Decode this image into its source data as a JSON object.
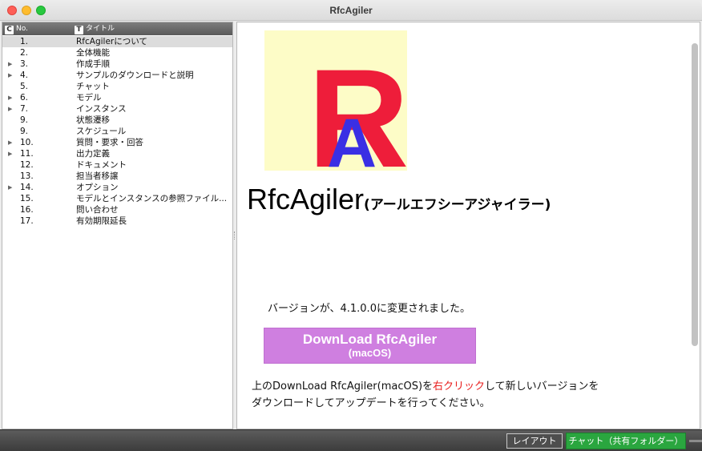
{
  "window": {
    "title": "RfcAgiler"
  },
  "sidebar": {
    "header": {
      "no_icon": "C",
      "no_label": "No.",
      "title_icon": "T",
      "title_label": "タイトル"
    },
    "rows": [
      {
        "no": "1.",
        "title": "RfcAgilerについて",
        "expandable": false,
        "selected": true
      },
      {
        "no": "2.",
        "title": "全体機能",
        "expandable": false
      },
      {
        "no": "3.",
        "title": "作成手順",
        "expandable": true
      },
      {
        "no": "4.",
        "title": "サンプルのダウンロードと説明",
        "expandable": true
      },
      {
        "no": "5.",
        "title": "チャット",
        "expandable": false
      },
      {
        "no": "6.",
        "title": "モデル",
        "expandable": true
      },
      {
        "no": "7.",
        "title": "インスタンス",
        "expandable": true
      },
      {
        "no": "9.",
        "title": "状態遷移",
        "expandable": false
      },
      {
        "no": "9.",
        "title": "スケジュール",
        "expandable": false
      },
      {
        "no": "10.",
        "title": "質問・要求・回答",
        "expandable": true
      },
      {
        "no": "11.",
        "title": "出力定義",
        "expandable": true
      },
      {
        "no": "12.",
        "title": "ドキュメント",
        "expandable": false
      },
      {
        "no": "13.",
        "title": "担当者移譲",
        "expandable": false
      },
      {
        "no": "14.",
        "title": "オプション",
        "expandable": true
      },
      {
        "no": "15.",
        "title": "モデルとインスタンスの参照ファイル...",
        "expandable": false
      },
      {
        "no": "16.",
        "title": "問い合わせ",
        "expandable": false
      },
      {
        "no": "17.",
        "title": "有効期限延長",
        "expandable": false
      }
    ]
  },
  "content": {
    "logo": {
      "letter_large": "R",
      "letter_small": "A",
      "bg_color": "#fdfcc7",
      "r_color": "#ee1d3a",
      "a_color": "#3a2fe4"
    },
    "heading_main": "RfcAgiler",
    "heading_kana": "(アールエフシーアジャイラー)",
    "version_text": "バージョンが、4.1.0.0に変更されました。",
    "download_button": {
      "line1": "DownLoad RfcAgiler",
      "line2": "(macOS)"
    },
    "instructions": {
      "part1": "上のDownLoad RfcAgiler(macOS)を",
      "highlight": "右クリック",
      "part2": "して新しいバージョンを",
      "line2": "ダウンロードしてアップデートを行ってください。"
    }
  },
  "bottombar": {
    "layout_button": "レイアウト",
    "chat_button": "チャット（共有フォルダー）"
  }
}
